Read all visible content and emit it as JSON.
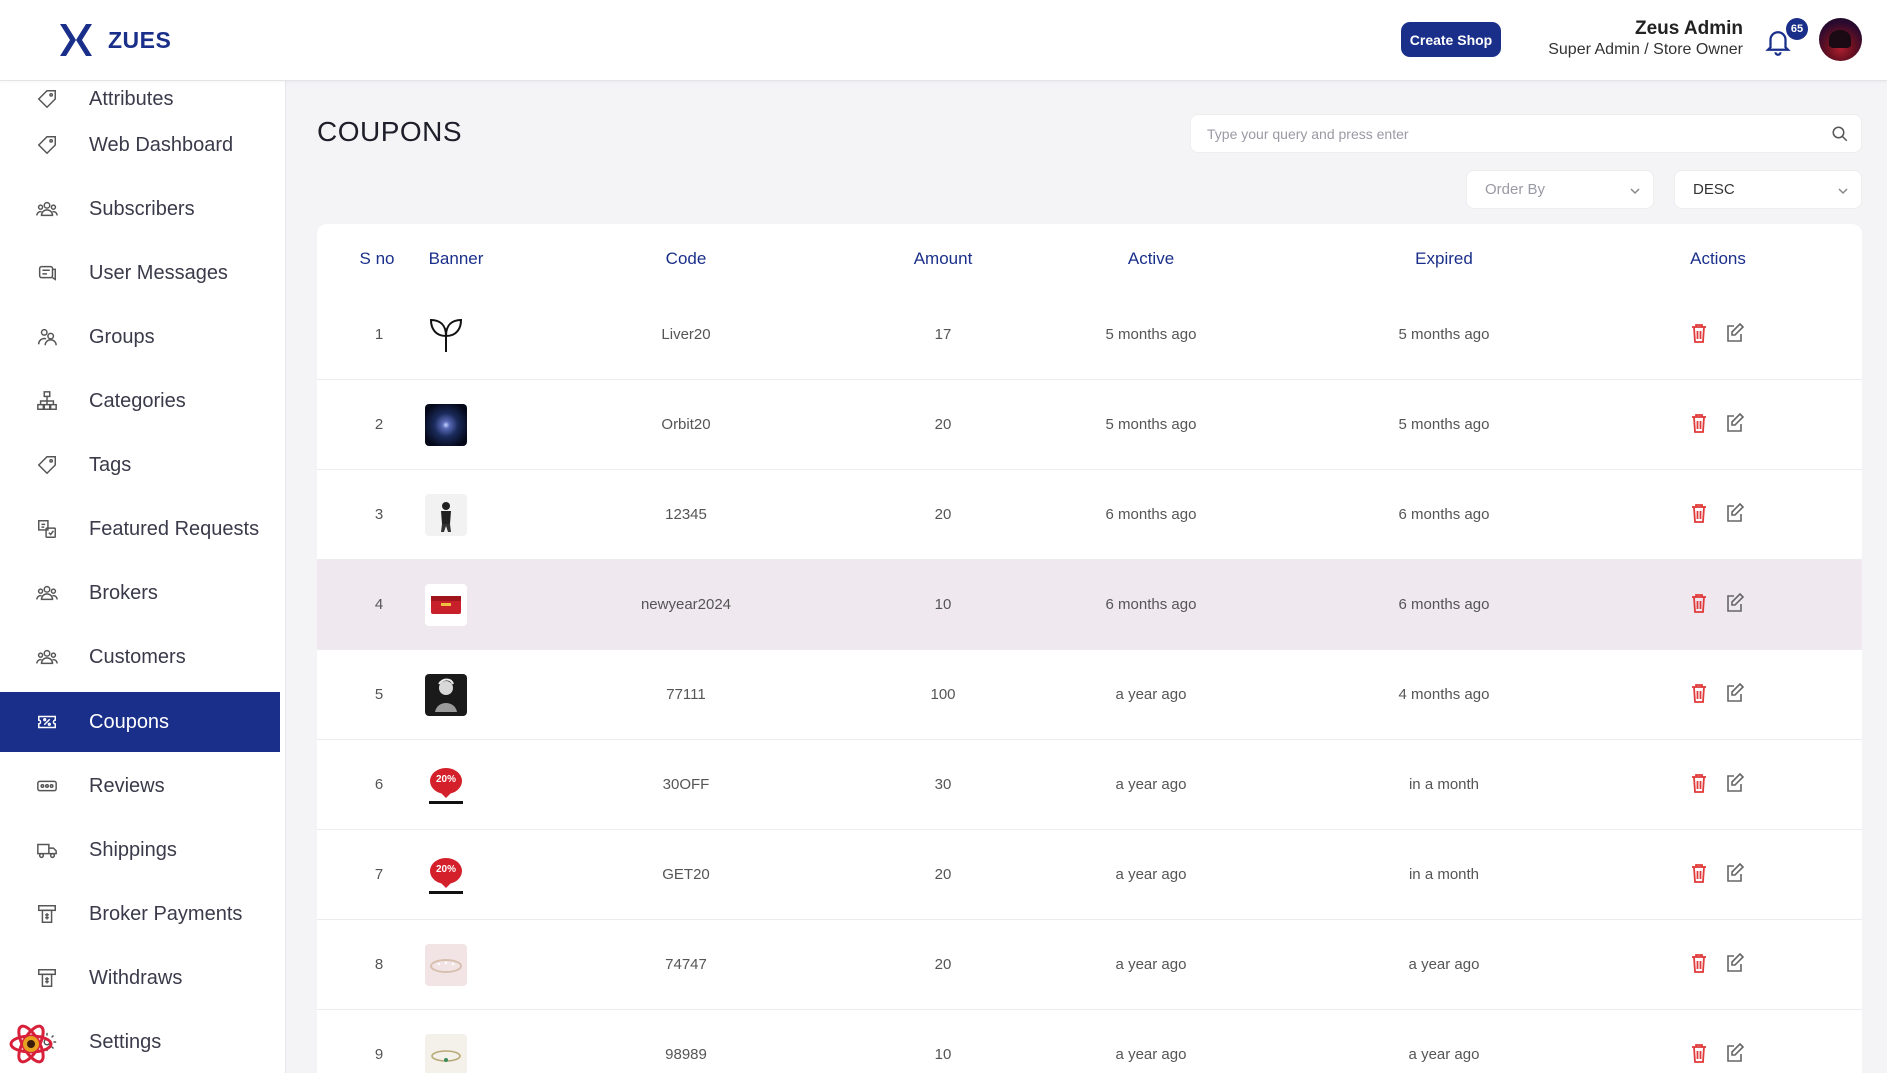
{
  "brand": {
    "name": "ZUES"
  },
  "header": {
    "create_shop_label": "Create Shop",
    "user_name": "Zeus Admin",
    "user_role": "Super Admin / Store Owner",
    "notification_count": "65"
  },
  "sidebar": {
    "items": [
      {
        "label": "Attributes",
        "icon": "tag-icon"
      },
      {
        "label": "Web Dashboard",
        "icon": "tag-icon"
      },
      {
        "label": "Subscribers",
        "icon": "users-icon"
      },
      {
        "label": "User Messages",
        "icon": "message-icon"
      },
      {
        "label": "Groups",
        "icon": "groups-icon"
      },
      {
        "label": "Categories",
        "icon": "hierarchy-icon"
      },
      {
        "label": "Tags",
        "icon": "tag-icon"
      },
      {
        "label": "Featured Requests",
        "icon": "featured-icon"
      },
      {
        "label": "Brokers",
        "icon": "users-icon"
      },
      {
        "label": "Customers",
        "icon": "users-icon"
      },
      {
        "label": "Coupons",
        "icon": "coupon-icon",
        "active": true
      },
      {
        "label": "Reviews",
        "icon": "reviews-icon"
      },
      {
        "label": "Shippings",
        "icon": "truck-icon"
      },
      {
        "label": "Broker Payments",
        "icon": "payment-icon"
      },
      {
        "label": "Withdraws",
        "icon": "payment-icon"
      },
      {
        "label": "Settings",
        "icon": "settings-icon"
      }
    ]
  },
  "page": {
    "title": "COUPONS",
    "search_placeholder": "Type your query and press enter",
    "order_by_placeholder": "Order By",
    "sort_direction": "DESC"
  },
  "table": {
    "headers": [
      "S no",
      "Banner",
      "Code",
      "Amount",
      "Active",
      "Expired",
      "Actions"
    ],
    "rows": [
      {
        "sno": "1",
        "banner": "plant-sprout-icon",
        "code": "Liver20",
        "amount": "17",
        "active": "5 months ago",
        "expired": "5 months ago"
      },
      {
        "sno": "2",
        "banner": "galaxy-image",
        "code": "Orbit20",
        "amount": "20",
        "active": "5 months ago",
        "expired": "5 months ago"
      },
      {
        "sno": "3",
        "banner": "person-image",
        "code": "12345",
        "amount": "20",
        "active": "6 months ago",
        "expired": "6 months ago"
      },
      {
        "sno": "4",
        "banner": "red-envelope-image",
        "code": "newyear2024",
        "amount": "10",
        "active": "6 months ago",
        "expired": "6 months ago",
        "highlight": true
      },
      {
        "sno": "5",
        "banner": "photo-image",
        "code": "77111",
        "amount": "100",
        "active": "a year ago",
        "expired": "4 months ago"
      },
      {
        "sno": "6",
        "banner": "discount-badge-image",
        "code": "30OFF",
        "amount": "30",
        "active": "a year ago",
        "expired": "in a month"
      },
      {
        "sno": "7",
        "banner": "discount-badge-image",
        "code": "GET20",
        "amount": "20",
        "active": "a year ago",
        "expired": "in a month"
      },
      {
        "sno": "8",
        "banner": "bracelet-image",
        "code": "74747",
        "amount": "20",
        "active": "a year ago",
        "expired": "a year ago"
      },
      {
        "sno": "9",
        "banner": "bracelet-image",
        "code": "98989",
        "amount": "10",
        "active": "a year ago",
        "expired": "a year ago"
      }
    ]
  },
  "colors": {
    "primary": "#1a2f8a",
    "delete": "#e03a3a",
    "highlight_row": "#f0e8ef"
  }
}
